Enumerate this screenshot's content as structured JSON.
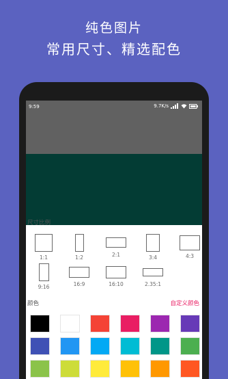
{
  "promo": {
    "title": "纯色图片",
    "subtitle": "常用尺寸、精选配色"
  },
  "status_bar": {
    "time": "9:59",
    "speed": "9.7K/s"
  },
  "preview": {
    "gray": "#616161",
    "selected_color": "#033c34"
  },
  "ratio_section": {
    "title": "尺寸比例",
    "ratios": [
      "1:1",
      "1:2",
      "2:1",
      "3:4",
      "4:3",
      "9:16",
      "16:9",
      "16:10",
      "2.35:1"
    ]
  },
  "color_section": {
    "title": "颜色",
    "custom_label": "自定义颜色",
    "custom_color": "#e91e63",
    "swatches": [
      "#000000",
      "#ffffff",
      "#f44336",
      "#e91e63",
      "#9c27b0",
      "#673ab7",
      "#3f51b5",
      "#2196f3",
      "#03a9f4",
      "#00bcd4",
      "#009688",
      "#4caf50",
      "#8bc34a",
      "#cddc39",
      "#ffeb3b",
      "#ffc107",
      "#ff9800",
      "#ff5722"
    ]
  }
}
